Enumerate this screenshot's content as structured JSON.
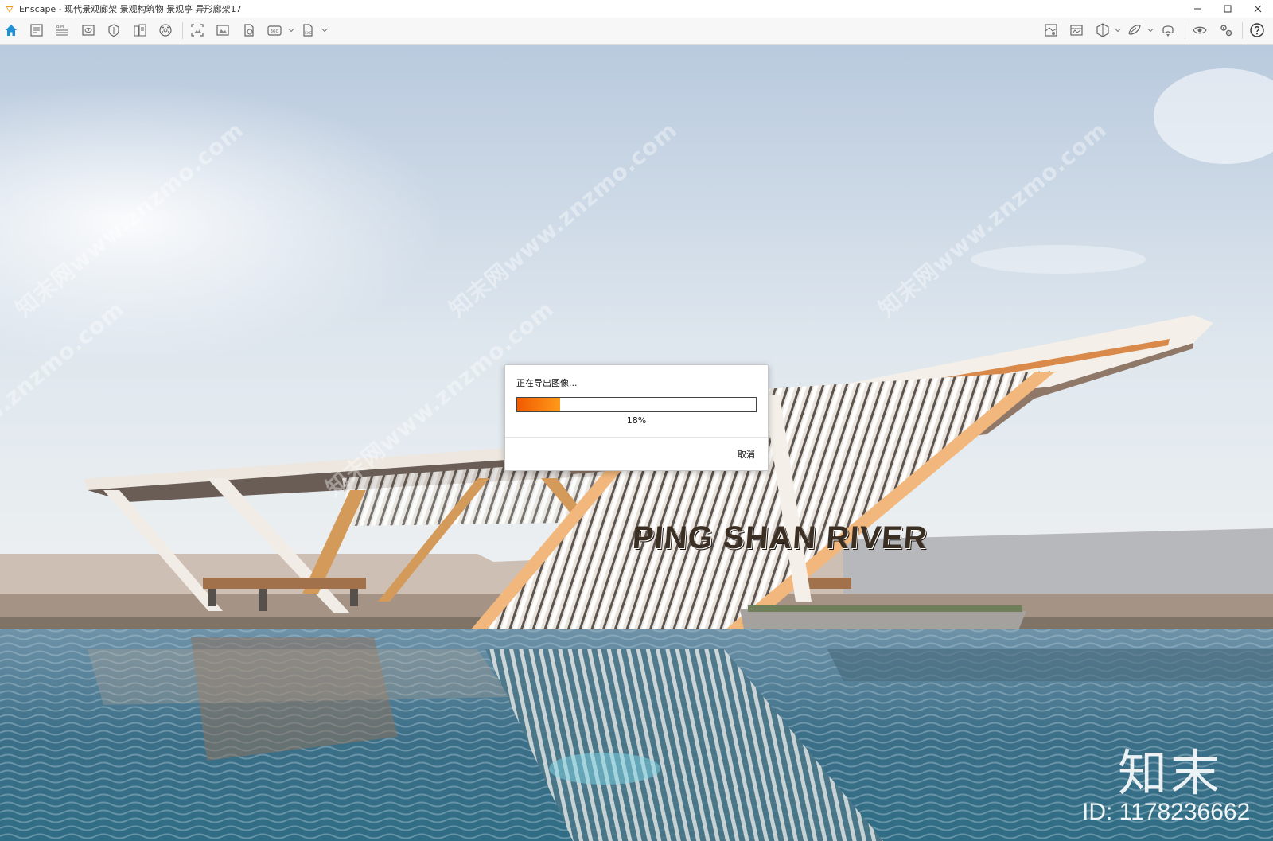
{
  "window": {
    "title": "Enscape - 现代景观廊架 景观构筑物 景观亭 异形廊架17",
    "accent_color": "#f29b1f"
  },
  "toolbar": {
    "left_icons": [
      "home-icon",
      "project-info-icon",
      "bim-icon",
      "views-icon",
      "sun-icon",
      "asset-library-icon",
      "material-editor-icon",
      "screenshot-icon",
      "batch-render-icon",
      "video-icon",
      "panorama-360-icon",
      "exe-export-icon"
    ],
    "right_icons": [
      "site-context-icon",
      "atmosphere-icon",
      "section-box-icon",
      "feedback-icon",
      "vr-headset-icon",
      "visibility-icon",
      "settings-icon",
      "help-icon"
    ]
  },
  "scene": {
    "sign_text": "PING SHAN RIVER",
    "watermark": "知末网www.znzmo.com",
    "brand": "知末",
    "brand_id": "ID: 1178236662"
  },
  "dialog": {
    "title": "正在导出图像...",
    "progress": 0.18,
    "progress_label": "18%",
    "cancel_label": "取消",
    "fill_color": "#f26a0a"
  }
}
